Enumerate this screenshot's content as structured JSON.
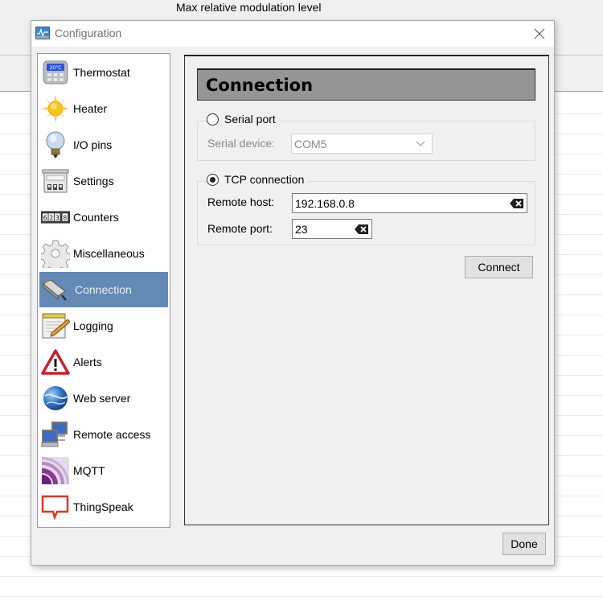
{
  "background_app": {
    "heading": "Max relative modulation level"
  },
  "dialog": {
    "title": "Configuration",
    "close_label": "Close"
  },
  "sidebar": {
    "selected": "Connection",
    "items": [
      {
        "label": "Thermostat",
        "icon": "thermostat-icon"
      },
      {
        "label": "Heater",
        "icon": "sun-icon"
      },
      {
        "label": "I/O pins",
        "icon": "lightbulb-icon"
      },
      {
        "label": "Settings",
        "icon": "switchboard-icon"
      },
      {
        "label": "Counters",
        "icon": "counter-icon"
      },
      {
        "label": "Miscellaneous",
        "icon": "gear-icon"
      },
      {
        "label": "Connection",
        "icon": "network-plug-icon"
      },
      {
        "label": "Logging",
        "icon": "notepad-pencil-icon"
      },
      {
        "label": "Alerts",
        "icon": "warning-icon"
      },
      {
        "label": "Web server",
        "icon": "globe-icon"
      },
      {
        "label": "Remote access",
        "icon": "computers-icon"
      },
      {
        "label": "MQTT",
        "icon": "mqtt-icon"
      },
      {
        "label": "ThingSpeak",
        "icon": "speech-bubble-icon"
      }
    ]
  },
  "panel": {
    "title": "Connection",
    "serial": {
      "radio_label": "Serial port",
      "checked": false,
      "device_label": "Serial device:",
      "device_value": "COM5"
    },
    "tcp": {
      "radio_label": "TCP connection",
      "checked": true,
      "host_label": "Remote host:",
      "host_value": "192.168.0.8",
      "port_label": "Remote port:",
      "port_value": "23"
    },
    "connect_label": "Connect"
  },
  "footer": {
    "done_label": "Done"
  },
  "colors": {
    "selection": "#6389b4",
    "header_bg": "#959595",
    "dialog_bg": "#f0f0f0",
    "thingspeak_red": "#d9391f",
    "mqtt_purple": "#7a2a8a"
  }
}
